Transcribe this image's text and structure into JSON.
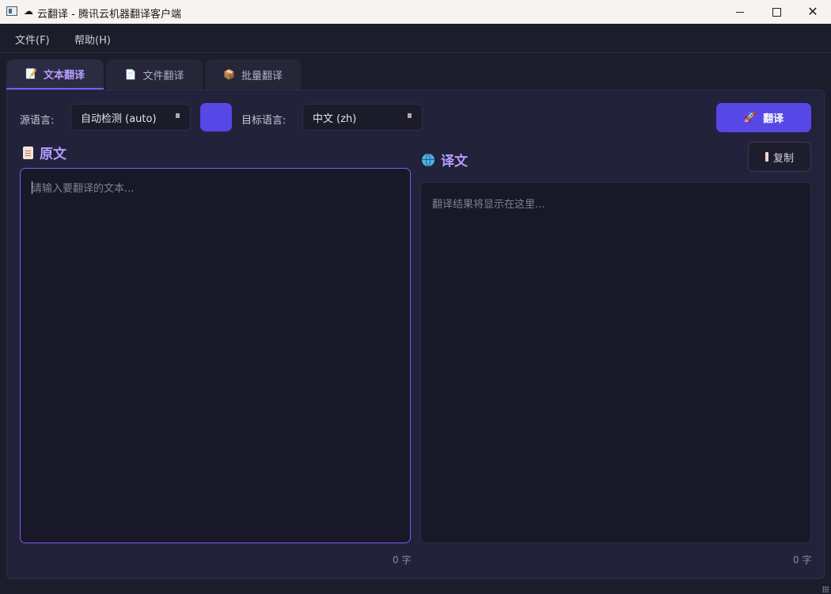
{
  "window": {
    "title": "云翻译 - 腾讯云机器翻译客户端",
    "title_icon": "☁",
    "minimize_icon": "minimize-icon",
    "maximize_icon": "maximize-icon",
    "close_icon": "✕"
  },
  "menu": {
    "items": [
      {
        "label": "文件(F)"
      },
      {
        "label": "帮助(H)"
      }
    ]
  },
  "tabs": [
    {
      "label": "文本翻译",
      "icon": "📝",
      "active": true
    },
    {
      "label": "文件翻译",
      "icon": "📄",
      "active": false
    },
    {
      "label": "批量翻译",
      "icon": "📦",
      "active": false
    }
  ],
  "toolbar": {
    "source_label": "源语言:",
    "source_value": "自动检测 (auto)",
    "target_label": "目标语言:",
    "target_value": "中文 (zh)",
    "translate_label": "翻译",
    "translate_icon": "🚀"
  },
  "source": {
    "title": "原文",
    "placeholder": "请输入要翻译的文本...",
    "value": "",
    "count": "0 字"
  },
  "result": {
    "title": "译文",
    "placeholder": "翻译结果将显示在这里...",
    "copy_label": "复制",
    "count": "0 字"
  },
  "colors": {
    "accent": "#5647e6",
    "accent_text": "#b69cff",
    "background": "#1c1c2b",
    "panel": "#22223a"
  }
}
